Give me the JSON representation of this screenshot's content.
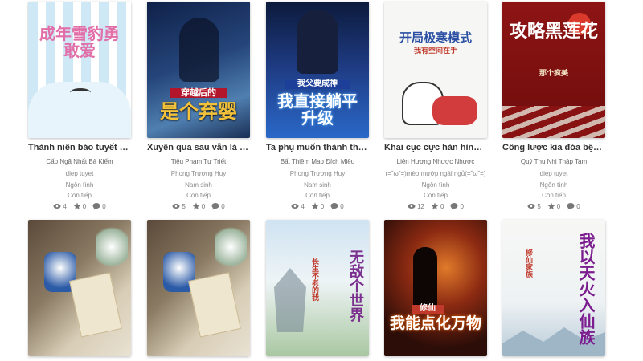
{
  "colors": {
    "title": "#333333",
    "meta": "#8a8a8a",
    "icon": "#777777"
  },
  "stat_icons": [
    "eye-icon",
    "star-icon",
    "comment-icon"
  ],
  "books": [
    {
      "cover_text": "成年雪豹勇敢爱",
      "title": "Thành niên báo tuyết d...",
      "author": "Cấp Ngã Nhất Bả Kiếm",
      "uploader": "diep tuyet",
      "genre": "Ngôn tình",
      "status": "Còn tiếp",
      "views": "4",
      "stars": "0",
      "comments": "0"
    },
    {
      "cover_text": "是个弃婴",
      "cover_sub": "穿越后的",
      "title": "Xuyên qua sau vẫn là c...",
      "author": "Tiêu Phạm Tự Triết",
      "uploader": "Phong Trương Huy",
      "genre": "Nam sinh",
      "status": "Còn tiếp",
      "views": "5",
      "stars": "0",
      "comments": "0"
    },
    {
      "cover_text": "我直接躺平升级",
      "cover_sub": "我父要成神",
      "title": "Ta phụ muốn thành thầ...",
      "author": "Bất Thiêm Mao Đích Miêu",
      "uploader": "Phong Trương Huy",
      "genre": "Nam sinh",
      "status": "Còn tiếp",
      "views": "4",
      "stars": "0",
      "comments": "0"
    },
    {
      "cover_text": "开局极寒模式",
      "cover_sub": "我有空间在手",
      "title": "Khai cục cực hàn hình ...",
      "author": "Liên Hương Nhược Nhược",
      "uploader": "(=ˇωˇ=)mèo mướp ngái ngủ(=ˇωˇ=)",
      "genre": "Ngôn tình",
      "status": "Còn tiếp",
      "views": "12",
      "stars": "0",
      "comments": "0"
    },
    {
      "cover_text": "攻略黑莲花",
      "cover_sub": "那个疯美",
      "title": "Công lược kia đóa bện...",
      "author": "Quý Thu Nhị Thập Tam",
      "uploader": "diep tuyet",
      "genre": "Ngôn tình",
      "status": "Còn tiếp",
      "views": "5",
      "stars": "0",
      "comments": "0"
    },
    {
      "cover_text": ""
    },
    {
      "cover_text": ""
    },
    {
      "cover_text": "无敌个世界",
      "cover_sub": "长生不老的我"
    },
    {
      "cover_text": "我能点化万物",
      "cover_sub": "修仙"
    },
    {
      "cover_text": "我以天火入仙族",
      "cover_sub": "修仙家族"
    }
  ]
}
